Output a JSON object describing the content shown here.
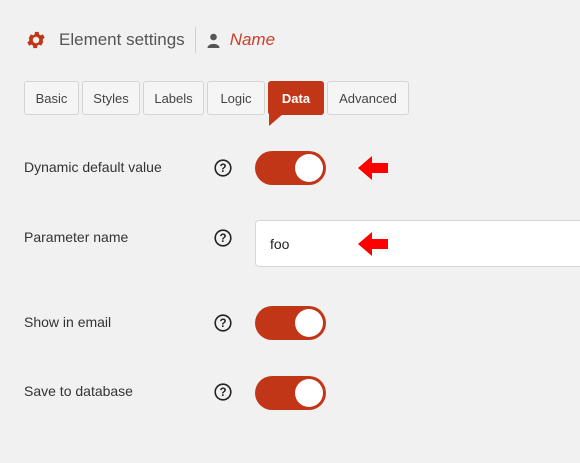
{
  "header": {
    "icon": "gear-icon",
    "title": "Element settings",
    "user_icon": "user-icon",
    "name": "Name"
  },
  "tabs": [
    {
      "label": "Basic",
      "active": false
    },
    {
      "label": "Styles",
      "active": false
    },
    {
      "label": "Labels",
      "active": false
    },
    {
      "label": "Logic",
      "active": false
    },
    {
      "label": "Data",
      "active": true
    },
    {
      "label": "Advanced",
      "active": false
    }
  ],
  "fields": {
    "dynamic_default": {
      "label": "Dynamic default value",
      "enabled": true
    },
    "parameter_name": {
      "label": "Parameter name",
      "value": "foo"
    },
    "show_in_email": {
      "label": "Show in email",
      "enabled": true
    },
    "save_to_database": {
      "label": "Save to database",
      "enabled": true
    }
  },
  "colors": {
    "accent": "#c23618",
    "name_text": "#c9402a",
    "annotation_arrow": "#ff0000"
  }
}
